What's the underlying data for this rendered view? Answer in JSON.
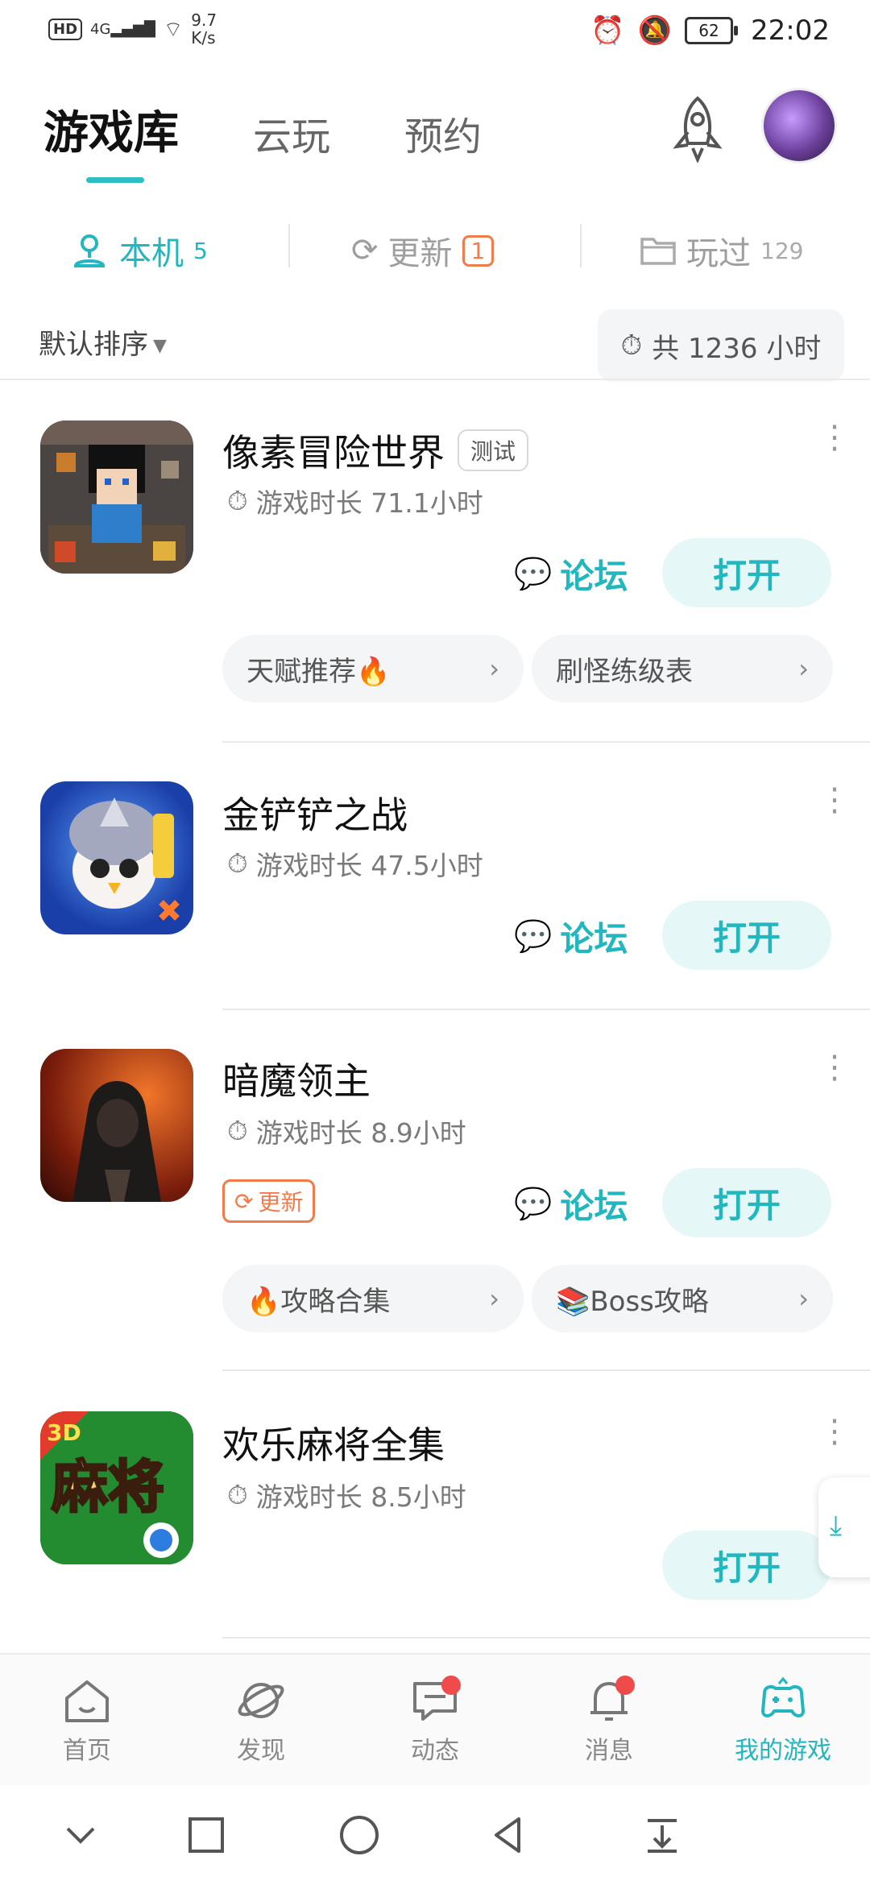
{
  "status_bar": {
    "hd": "HD",
    "signal": "4G",
    "speed_value": "9.7",
    "speed_unit": "K/s",
    "battery": "62",
    "time": "22:02"
  },
  "top_tabs": [
    "游戏库",
    "云玩",
    "预约"
  ],
  "segments": {
    "local": {
      "label": "本机",
      "count": "5"
    },
    "update": {
      "label": "更新",
      "count": "1"
    },
    "played": {
      "label": "玩过",
      "count": "129"
    }
  },
  "sort": {
    "label": "默认排序",
    "total": "共 1236 小时"
  },
  "common": {
    "forum": "论坛",
    "open": "打开"
  },
  "games": [
    {
      "title": "像素冒险世界",
      "tag": "测试",
      "playtime": "游戏时长 71.1小时",
      "chips": [
        {
          "label": "天赋推荐🔥"
        },
        {
          "label": "刷怪练级表"
        }
      ]
    },
    {
      "title": "金铲铲之战",
      "playtime": "游戏时长 47.5小时"
    },
    {
      "title": "暗魔领主",
      "playtime": "游戏时长 8.9小时",
      "update_badge": "更新",
      "chips": [
        {
          "label": "🔥攻略合集"
        },
        {
          "label": "📚Boss攻略"
        }
      ]
    },
    {
      "title": "欢乐麻将全集",
      "playtime": "游戏时长 8.5小时",
      "icon_text": "麻将",
      "icon_badge": "3D"
    }
  ],
  "bottom_nav": [
    "首页",
    "发现",
    "动态",
    "消息",
    "我的游戏"
  ],
  "colors": {
    "accent": "#22b6be",
    "update": "#ef7d4b",
    "badge_red": "#f04b4b"
  }
}
